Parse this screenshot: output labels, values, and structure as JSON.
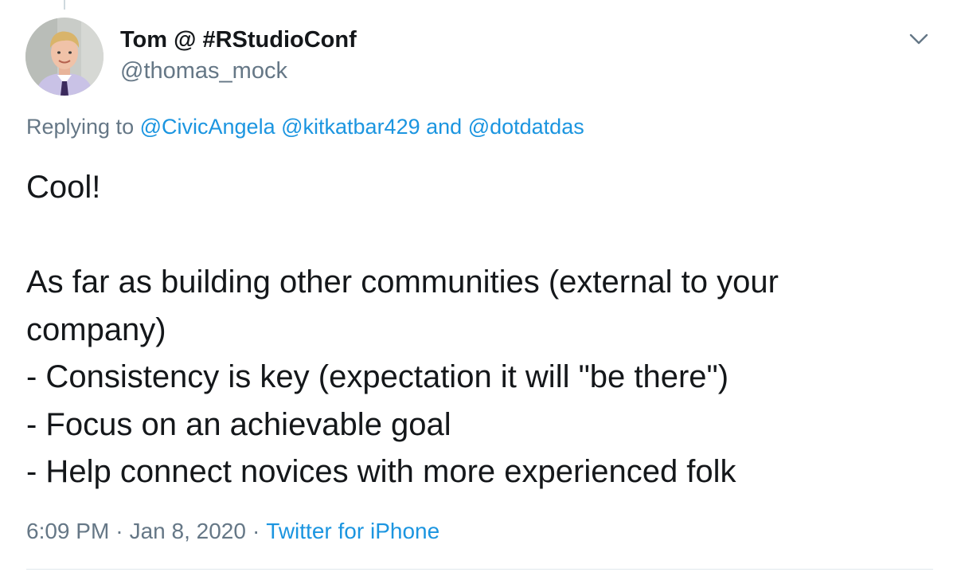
{
  "author": {
    "display_name": "Tom @ #RStudioConf",
    "handle": "@thomas_mock"
  },
  "reply": {
    "prefix": "Replying to",
    "mention_1": "@CivicAngela",
    "mention_2": "@kitkatbar429",
    "joiner": "and",
    "mention_3": "@dotdatdas"
  },
  "tweet": {
    "lines": [
      "Cool!",
      "",
      "As far as building other communities (external to your",
      "company)",
      "- Consistency is key (expectation it will \"be there\")",
      "- Focus on an achievable goal",
      "- Help connect novices with more experienced folk"
    ]
  },
  "meta": {
    "time": "6:09 PM",
    "separator": "·",
    "date": "Jan 8, 2020",
    "source": "Twitter for iPhone"
  },
  "icons": {
    "more": "chevron-down-icon"
  },
  "colors": {
    "link": "#1b95e0",
    "secondary_text": "#657786",
    "primary_text": "#14171a"
  }
}
